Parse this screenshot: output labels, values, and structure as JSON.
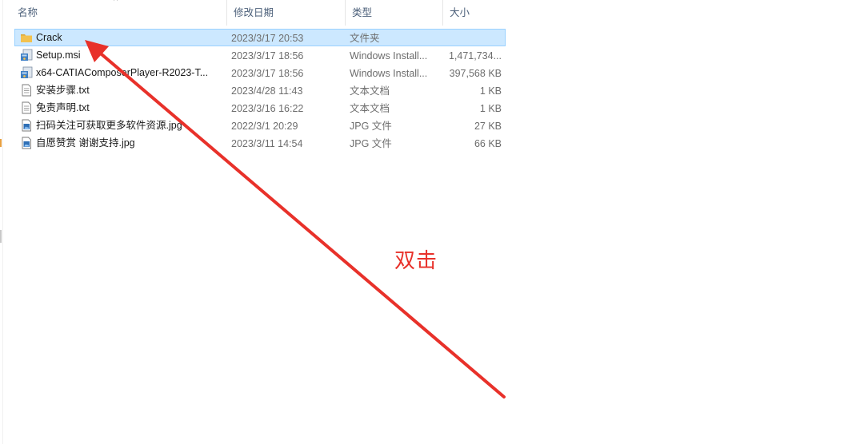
{
  "header": {
    "columns": [
      {
        "key": "name",
        "label": "名称"
      },
      {
        "key": "date",
        "label": "修改日期"
      },
      {
        "key": "type",
        "label": "类型"
      },
      {
        "key": "size",
        "label": "大小"
      }
    ],
    "sort_indicator": "^"
  },
  "files": [
    {
      "name": "Crack",
      "date": "2023/3/17 20:53",
      "type": "文件夹",
      "size": "",
      "icon": "folder-icon",
      "selected": true
    },
    {
      "name": "Setup.msi",
      "date": "2023/3/17 18:56",
      "type": "Windows Install...",
      "size": "1,471,734...",
      "icon": "installer-icon",
      "selected": false
    },
    {
      "name": "x64-CATIAComposerPlayer-R2023-T...",
      "date": "2023/3/17 18:56",
      "type": "Windows Install...",
      "size": "397,568 KB",
      "icon": "installer-icon",
      "selected": false
    },
    {
      "name": "安装步骤.txt",
      "date": "2023/4/28 11:43",
      "type": "文本文档",
      "size": "1 KB",
      "icon": "text-file-icon",
      "selected": false
    },
    {
      "name": "免责声明.txt",
      "date": "2023/3/16 16:22",
      "type": "文本文档",
      "size": "1 KB",
      "icon": "text-file-icon",
      "selected": false
    },
    {
      "name": "扫码关注可获取更多软件资源.jpg",
      "date": "2022/3/1 20:29",
      "type": "JPG 文件",
      "size": "27 KB",
      "icon": "image-file-icon",
      "selected": false
    },
    {
      "name": "自愿赞赏 谢谢支持.jpg",
      "date": "2023/3/11 14:54",
      "type": "JPG 文件",
      "size": "66 KB",
      "icon": "image-file-icon",
      "selected": false
    }
  ],
  "annotation": {
    "text": "双击",
    "color": "#e8312a"
  },
  "colors": {
    "selection_bg": "#cce8ff",
    "selection_border": "#99d1ff",
    "header_text": "#4c607a",
    "folder": "#f2c14e"
  }
}
